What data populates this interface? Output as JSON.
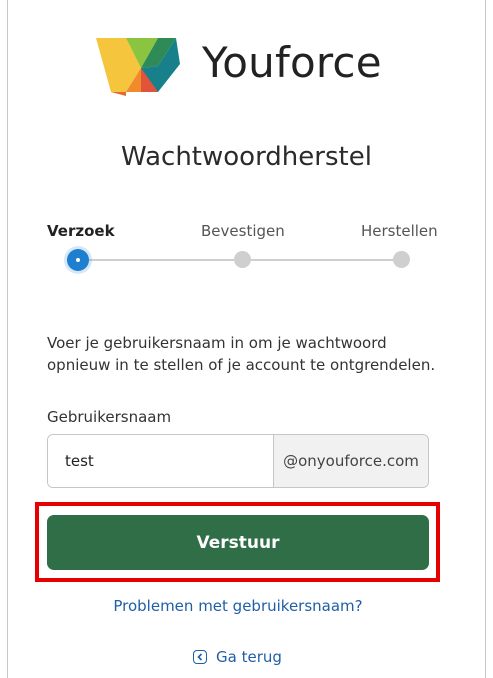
{
  "logo": {
    "text": "Youforce"
  },
  "page_title": "Wachtwoordherstel",
  "steps": [
    {
      "label": "Verzoek",
      "state": "active"
    },
    {
      "label": "Bevestigen",
      "state": "pending"
    },
    {
      "label": "Herstellen",
      "state": "pending"
    }
  ],
  "description": "Voer je gebruikersnaam in om je wachtwoord opnieuw in te stellen of je account te ontgrendelen.",
  "username": {
    "label": "Gebruikersnaam",
    "value": "test",
    "suffix": "@onyouforce.com"
  },
  "submit_label": "Verstuur",
  "username_problems_link": "Problemen met gebruikersnaam?",
  "back_link": "Ga terug",
  "colors": {
    "primary_button": "#2f6e46",
    "active_step": "#1e7fd0",
    "link": "#1f5fa8",
    "highlight": "#e60000"
  }
}
